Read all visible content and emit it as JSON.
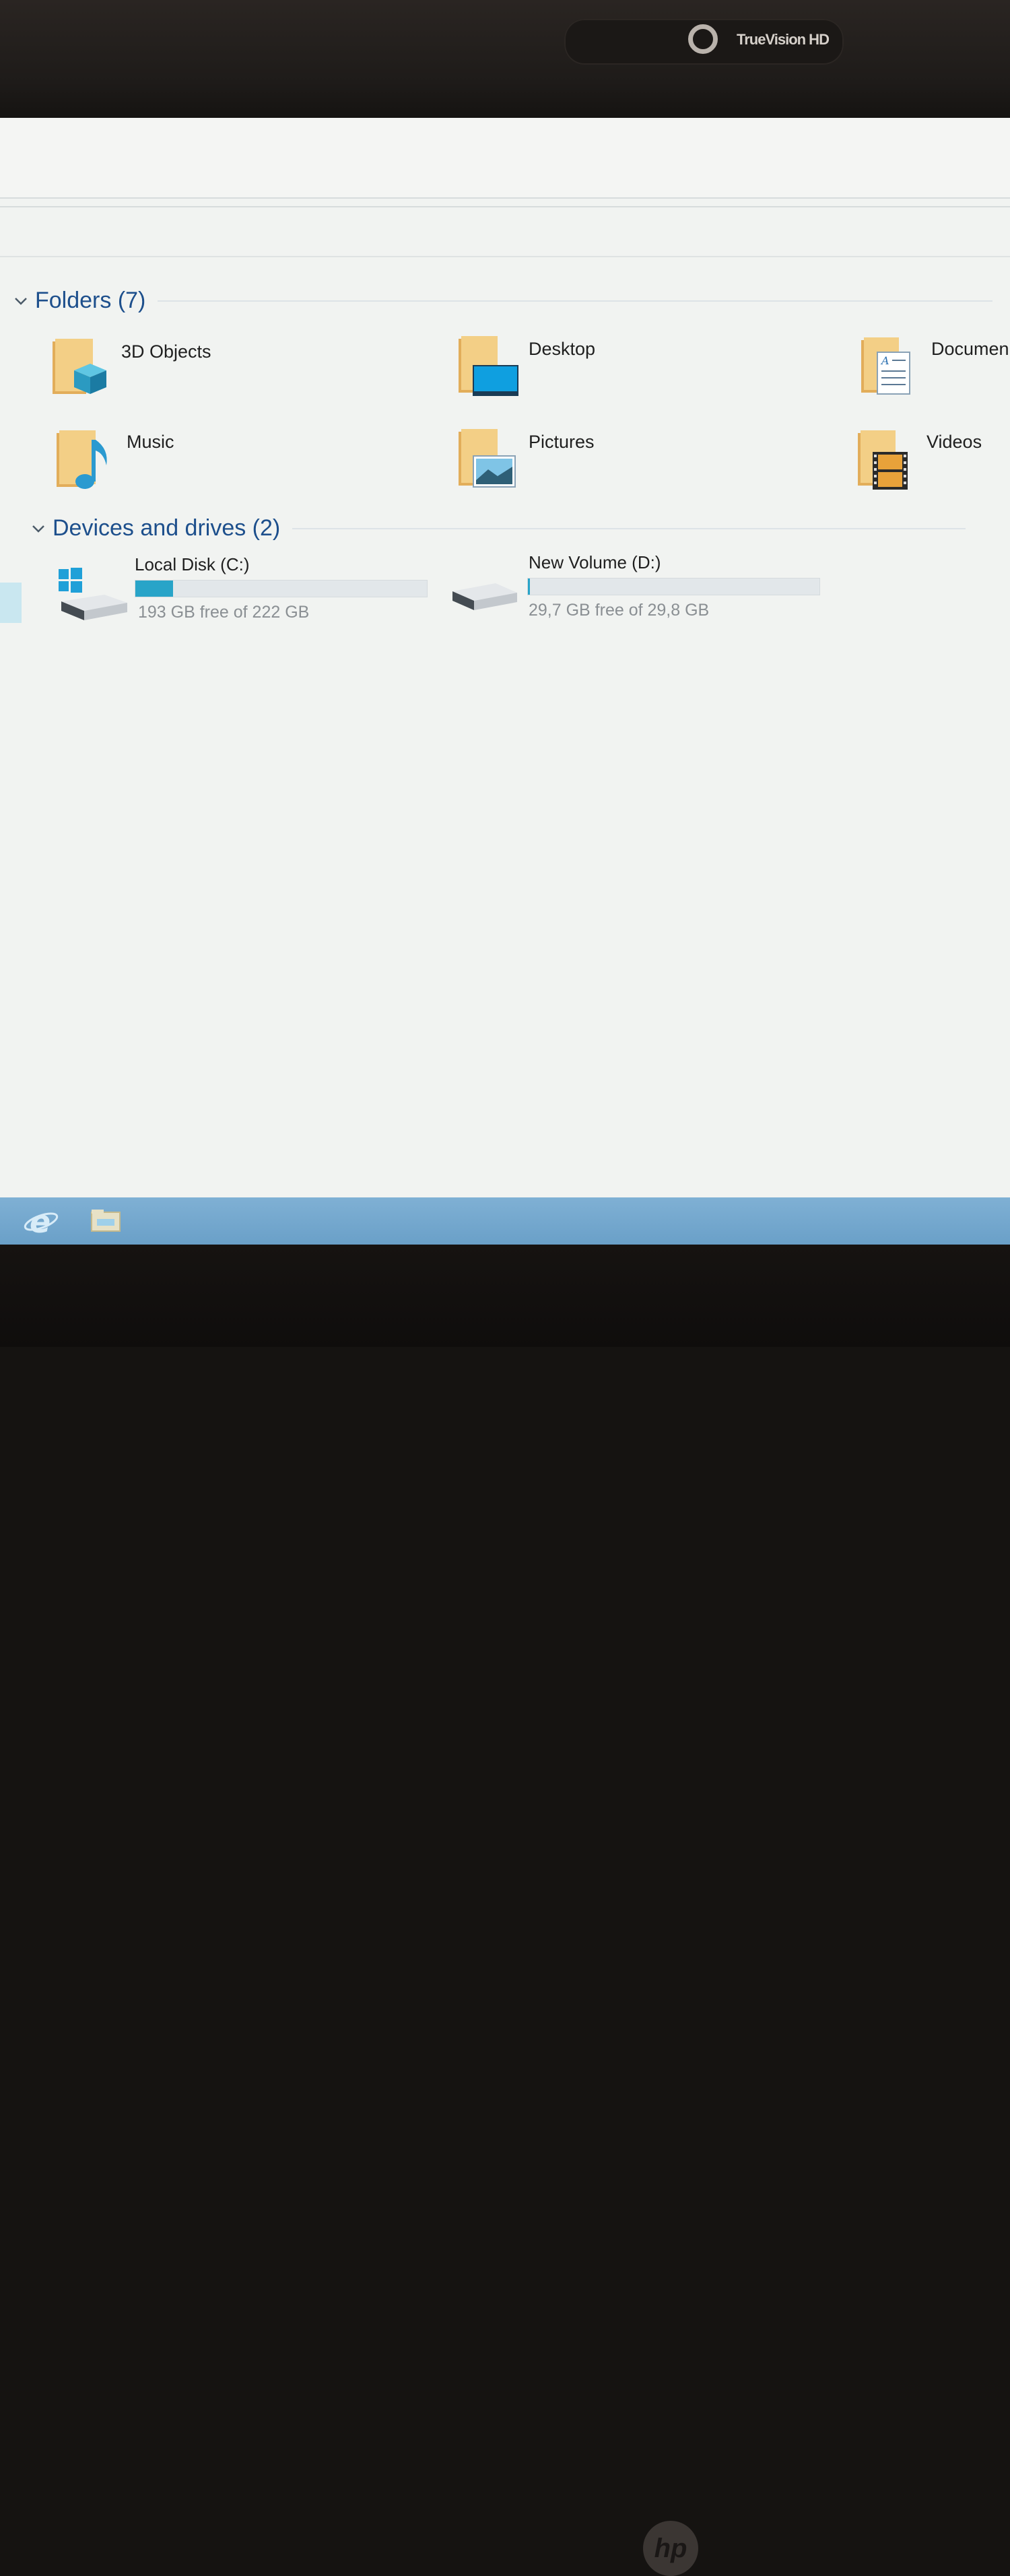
{
  "bezel": {
    "camera_label": "TrueVision HD",
    "brand_logo": "hp"
  },
  "explorer": {
    "folders_header": "Folders (7)",
    "folders": [
      {
        "label": "3D Objects",
        "icon": "3d-objects-folder-icon"
      },
      {
        "label": "Desktop",
        "icon": "desktop-folder-icon"
      },
      {
        "label": "Documen",
        "icon": "documents-folder-icon"
      },
      {
        "label": "Music",
        "icon": "music-folder-icon"
      },
      {
        "label": "Pictures",
        "icon": "pictures-folder-icon"
      },
      {
        "label": "Videos",
        "icon": "videos-folder-icon"
      }
    ],
    "drives_header": "Devices and drives (2)",
    "drives": [
      {
        "name": "Local Disk (C:)",
        "free_text": "193 GB free of 222 GB",
        "used_fraction": 0.13,
        "icon": "windows-drive-icon"
      },
      {
        "name": "New Volume (D:)",
        "free_text": "29,7 GB free of 29,8 GB",
        "used_fraction": 0.003,
        "icon": "drive-icon"
      }
    ]
  },
  "taskbar": {
    "items": [
      {
        "icon": "internet-explorer-icon"
      },
      {
        "icon": "file-explorer-icon"
      }
    ]
  },
  "colors": {
    "accent_header": "#1d4f8c",
    "bar_fill": "#28a4c8",
    "folder": "#f0c36d",
    "taskbar": "#6aa0c8"
  }
}
